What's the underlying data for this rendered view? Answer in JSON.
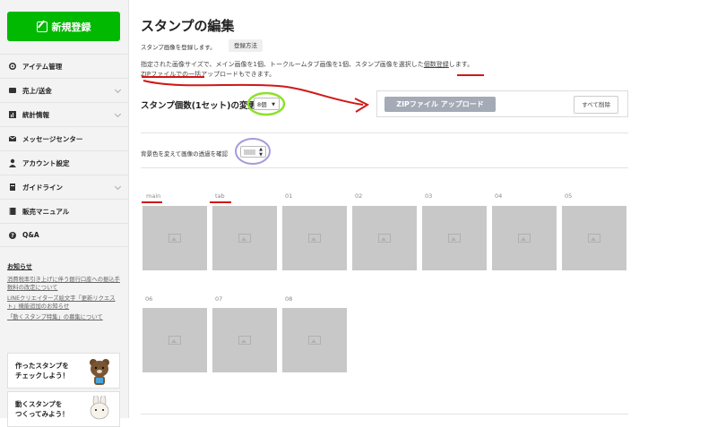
{
  "sidebar": {
    "new_button": "新規登録",
    "items": [
      {
        "label": "アイテム管理",
        "icon": "gear-icon",
        "chevron": false
      },
      {
        "label": "売上/送金",
        "icon": "wallet-icon",
        "chevron": true
      },
      {
        "label": "統計情報",
        "icon": "chart-icon",
        "chevron": true
      },
      {
        "label": "メッセージセンター",
        "icon": "mail-icon",
        "chevron": false
      },
      {
        "label": "アカウント設定",
        "icon": "user-icon",
        "chevron": false
      },
      {
        "label": "ガイドライン",
        "icon": "book-icon",
        "chevron": true
      },
      {
        "label": "販売マニュアル",
        "icon": "manual-icon",
        "chevron": false
      },
      {
        "label": "Q&A",
        "icon": "qa-icon",
        "chevron": false
      }
    ],
    "notice_title": "お知らせ",
    "notices": [
      "消費税率引き上げに伴う銀行口座への振込手数料の改定について",
      "LINEクリエイターズ絵文字「更新リクエスト」機能追加のお知らせ",
      "「動くスタンプ特集」の募集について"
    ],
    "banners": [
      {
        "line1": "作ったスタンプを",
        "line2": "チェックしよう！"
      },
      {
        "line1": "動くスタンプを",
        "line2": "つくってみよう！"
      }
    ]
  },
  "main": {
    "title": "スタンプの編集",
    "subtitle": "スタンプ画像を登録します。",
    "howto_button": "登録方法",
    "desc_line1_a": "指定された画像サイズで、メイン画像を1個、トークルームタブ画像を1個、スタンプ画像を選択した",
    "desc_line1_b": "個数登録",
    "desc_line1_c": "します。",
    "desc_line2": "ZIPファイルでの一括アップロードもできます。",
    "count_label": "スタンプ個数(1セット)の変更",
    "count_value": "8個",
    "zip_button": "ZIPファイル アップロード",
    "delete_all_button": "すべて削除",
    "bg_label": "背景色を変えて画像の透過を確認",
    "tiles_row1": [
      "main",
      "tab",
      "01",
      "02",
      "03",
      "04",
      "05"
    ],
    "tiles_row2": [
      "06",
      "07",
      "08"
    ]
  },
  "colors": {
    "brand_green": "#00b900",
    "annotation_red": "#d01818",
    "annotation_green": "#8ee02a",
    "annotation_purple": "#a79ad8"
  }
}
